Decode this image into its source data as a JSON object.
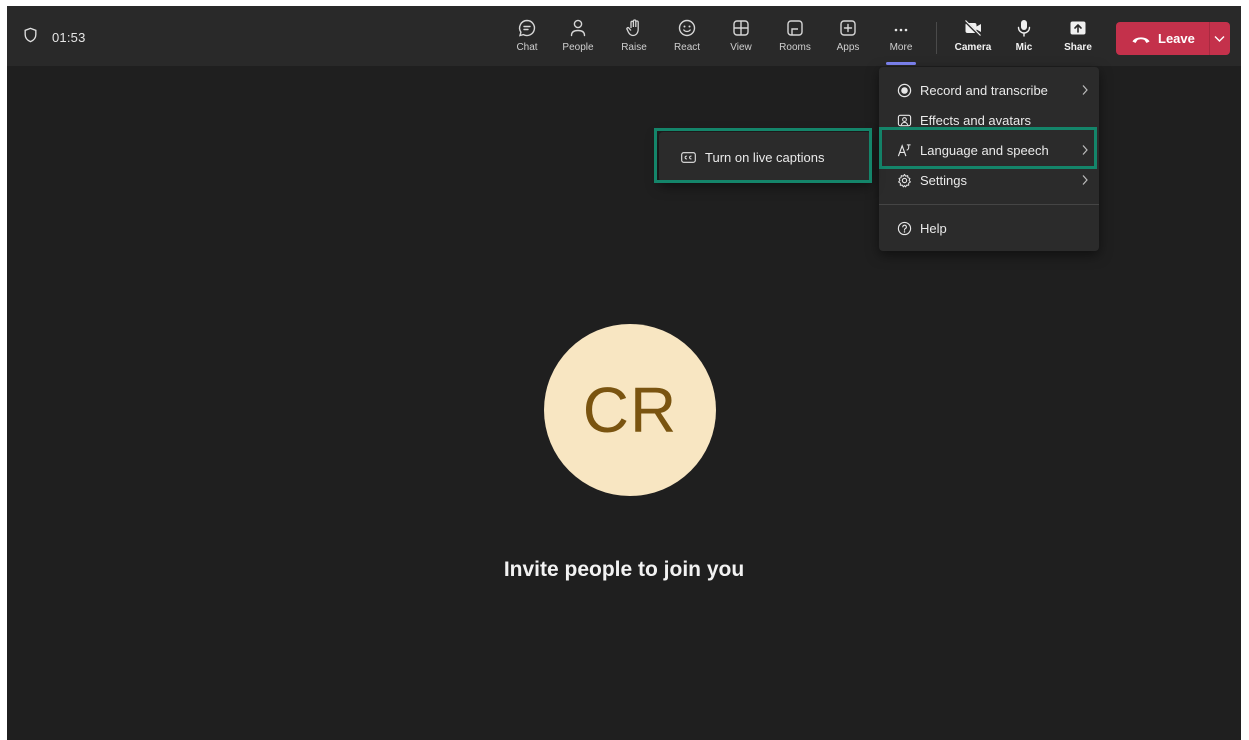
{
  "meeting": {
    "timer": "01:53",
    "shield_icon": "shield-icon"
  },
  "toolbar": {
    "items": [
      {
        "id": "chat",
        "label": "Chat",
        "icon": "chat-icon"
      },
      {
        "id": "people",
        "label": "People",
        "icon": "people-icon"
      },
      {
        "id": "raise",
        "label": "Raise",
        "icon": "raise-hand-icon"
      },
      {
        "id": "react",
        "label": "React",
        "icon": "smiley-icon"
      },
      {
        "id": "view",
        "label": "View",
        "icon": "grid-view-icon"
      },
      {
        "id": "rooms",
        "label": "Rooms",
        "icon": "rooms-icon"
      },
      {
        "id": "apps",
        "label": "Apps",
        "icon": "add-app-icon"
      },
      {
        "id": "more",
        "label": "More",
        "icon": "ellipsis-icon"
      },
      {
        "id": "camera",
        "label": "Camera",
        "icon": "camera-off-icon"
      },
      {
        "id": "mic",
        "label": "Mic",
        "icon": "microphone-icon"
      },
      {
        "id": "share",
        "label": "Share",
        "icon": "share-icon"
      }
    ],
    "leave_label": "Leave",
    "leave_color": "#c4314b",
    "active_indicator_color": "#7f85f5"
  },
  "more_menu": {
    "items": [
      {
        "label": "Record and transcribe",
        "icon": "record-icon",
        "has_submenu": true
      },
      {
        "label": "Effects and avatars",
        "icon": "effects-icon",
        "has_submenu": false
      },
      {
        "label": "Language and speech",
        "icon": "language-icon",
        "has_submenu": true,
        "highlighted": true
      },
      {
        "label": "Settings",
        "icon": "gear-icon",
        "has_submenu": true
      },
      {
        "label": "Help",
        "icon": "help-icon",
        "has_submenu": false
      }
    ]
  },
  "submenu": {
    "item_label": "Turn on live captions",
    "item_icon": "closed-captions-icon"
  },
  "highlight_color": "#14856a",
  "main": {
    "avatar_initials": "CR",
    "avatar_bg": "#f8e6c2",
    "avatar_fg": "#7a5410",
    "invite_text": "Invite people to join you"
  }
}
